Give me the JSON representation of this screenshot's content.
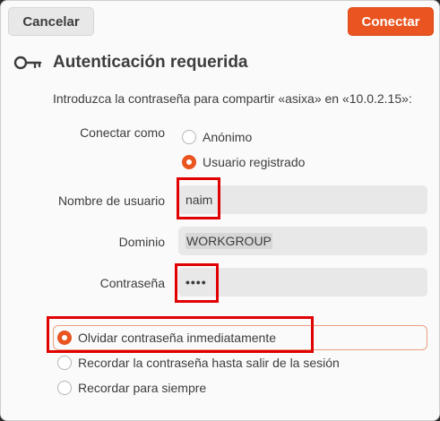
{
  "header": {
    "cancel_label": "Cancelar",
    "connect_label": "Conectar"
  },
  "title": "Autenticación requerida",
  "description": "Introduzca la contraseña para compartir «asixa» en «10.0.2.15»:",
  "connect_as": {
    "label": "Conectar como",
    "options": [
      {
        "label": "Anónimo",
        "selected": false
      },
      {
        "label": "Usuario registrado",
        "selected": true
      }
    ]
  },
  "fields": {
    "username": {
      "label": "Nombre de usuario",
      "value": "naim"
    },
    "domain": {
      "label": "Dominio",
      "value": "WORKGROUP"
    },
    "password": {
      "label": "Contraseña",
      "value": "••••"
    }
  },
  "remember": {
    "options": [
      {
        "label": "Olvidar contraseña inmediatamente",
        "selected": true
      },
      {
        "label": "Recordar la contraseña hasta salir de la sesión",
        "selected": false
      },
      {
        "label": "Recordar para siempre",
        "selected": false
      }
    ]
  },
  "colors": {
    "accent": "#e95420",
    "highlight_box": "#e00000"
  },
  "icons": {
    "title_icon": "key-icon"
  }
}
